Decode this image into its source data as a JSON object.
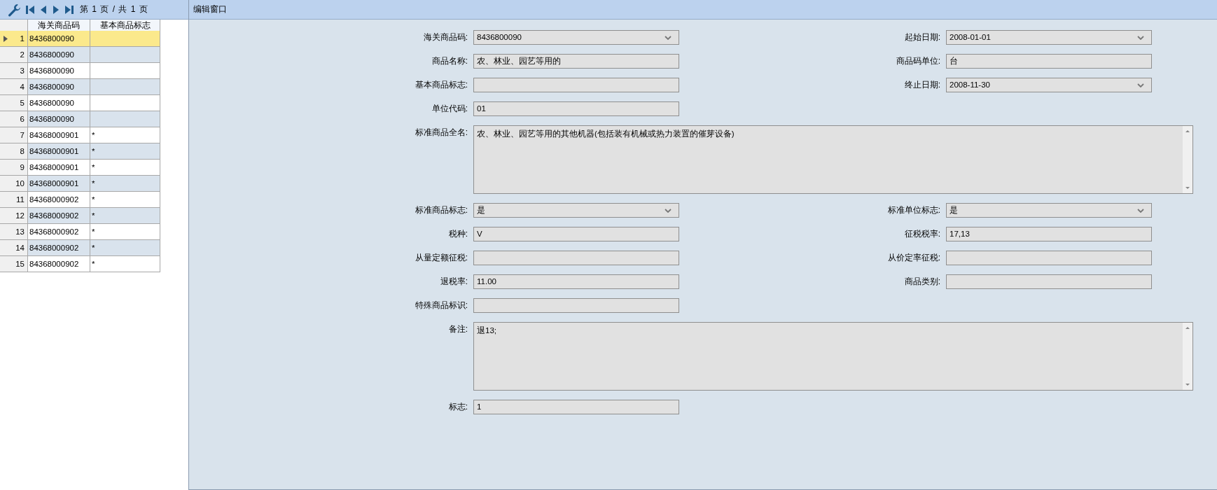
{
  "toolbar": {
    "pager": "第 1 页 / 共 1 页"
  },
  "grid": {
    "columns": [
      "海关商品码",
      "基本商品标志"
    ],
    "rows": [
      {
        "number": "1",
        "code": "8436800090",
        "selected": true
      },
      {
        "number": "2",
        "code": "8436800090",
        "selected": false
      },
      {
        "number": "3",
        "code": "8436800090",
        "selected": false
      },
      {
        "number": "4",
        "code": "8436800090",
        "selected": false
      },
      {
        "number": "5",
        "code": "8436800090",
        "selected": false
      },
      {
        "number": "6",
        "code": "8436800090",
        "selected": false
      },
      {
        "number": "7",
        "code": "84368000901",
        "flag": "*",
        "selected": false
      },
      {
        "number": "8",
        "code": "84368000901",
        "flag": "*",
        "selected": false
      },
      {
        "number": "9",
        "code": "84368000901",
        "flag": "*",
        "selected": false
      },
      {
        "number": "10",
        "code": "84368000901",
        "flag": "*",
        "selected": false
      },
      {
        "number": "11",
        "code": "84368000902",
        "flag": "*",
        "selected": false
      },
      {
        "number": "12",
        "code": "84368000902",
        "flag": "*",
        "selected": false
      },
      {
        "number": "13",
        "code": "84368000902",
        "flag": "*",
        "selected": false
      },
      {
        "number": "14",
        "code": "84368000902",
        "flag": "*",
        "selected": false
      },
      {
        "number": "15",
        "code": "84368000902",
        "flag": "*",
        "selected": false
      }
    ]
  },
  "editor": {
    "title": "编辑窗口",
    "rows": [
      [
        {
          "label": "海关商品码:",
          "kind": "select",
          "value": "8436800090"
        },
        {
          "label": "起始日期:",
          "kind": "select",
          "value": "2008-01-01"
        }
      ],
      [
        {
          "label": "商品名称:",
          "kind": "text",
          "value": "农、林业、园艺等用的"
        },
        {
          "label": "商品码单位:",
          "kind": "text",
          "value": "台"
        }
      ],
      [
        {
          "label": "基本商品标志:",
          "kind": "text"
        },
        {
          "label": "终止日期:",
          "kind": "select",
          "value": "2008-11-30"
        }
      ],
      [
        {
          "label": "单位代码:",
          "kind": "text",
          "value": "01"
        }
      ],
      [
        {
          "label": "标准商品全名:",
          "kind": "textarea",
          "value": "农、林业、园艺等用的其他机器(包括装有机械或热力装置的催芽设备)"
        }
      ],
      [
        {
          "label": "标准商品标志:",
          "kind": "select",
          "value": "是"
        },
        {
          "label": "标准单位标志:",
          "kind": "select",
          "value": "是"
        }
      ],
      [
        {
          "label": "税种:",
          "kind": "text",
          "value": "V"
        },
        {
          "label": "征税税率:",
          "kind": "text",
          "value": "17,13"
        }
      ],
      [
        {
          "label": "从量定额征税:",
          "kind": "text"
        },
        {
          "label": "从价定率征税:",
          "kind": "text"
        }
      ],
      [
        {
          "label": "退税率:",
          "kind": "text",
          "value": "11.00"
        },
        {
          "label": "商品类别:",
          "kind": "text"
        }
      ],
      [
        {
          "label": "特殊商品标识:",
          "kind": "text"
        }
      ],
      [
        {
          "label": "备注:",
          "kind": "textarea",
          "value": "退13;"
        }
      ],
      [
        {
          "label": "标志:",
          "kind": "text",
          "value": "1"
        }
      ]
    ]
  }
}
